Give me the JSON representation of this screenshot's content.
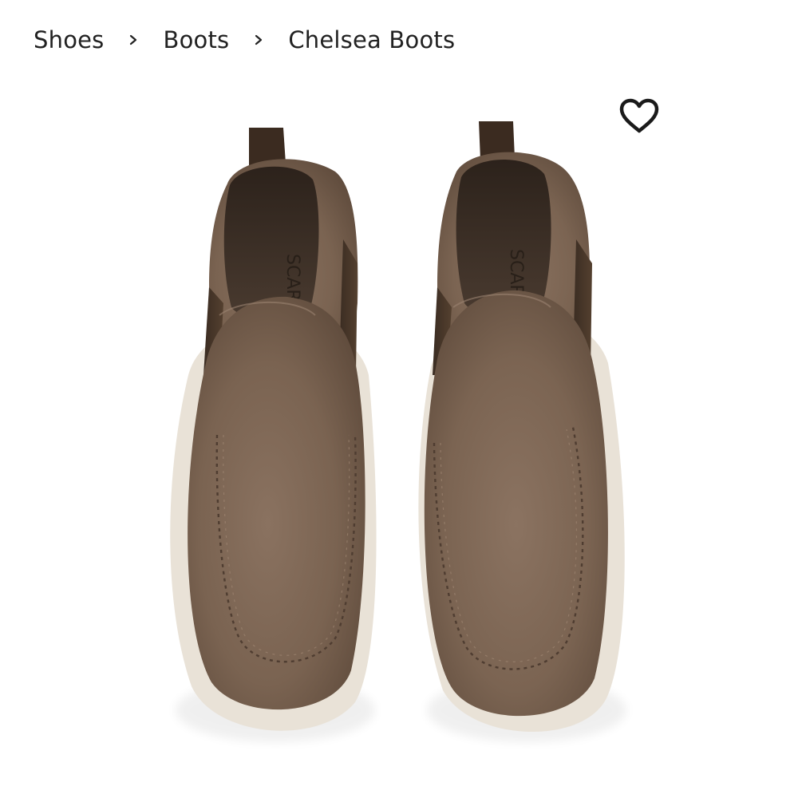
{
  "breadcrumb": {
    "items": [
      {
        "label": "Shoes"
      },
      {
        "label": "Boots"
      },
      {
        "label": "Chelsea Boots"
      }
    ],
    "separator_icon": "chevron-right-icon"
  },
  "wishlist": {
    "icon": "heart-outline-icon",
    "color": "#1a1a1a"
  },
  "product": {
    "image_description_color_suede": "#7a6452",
    "sole_color": "#e8e1d6",
    "brand_on_insole": "SCARO"
  },
  "colors": {
    "text": "#222222",
    "background": "#ffffff"
  }
}
